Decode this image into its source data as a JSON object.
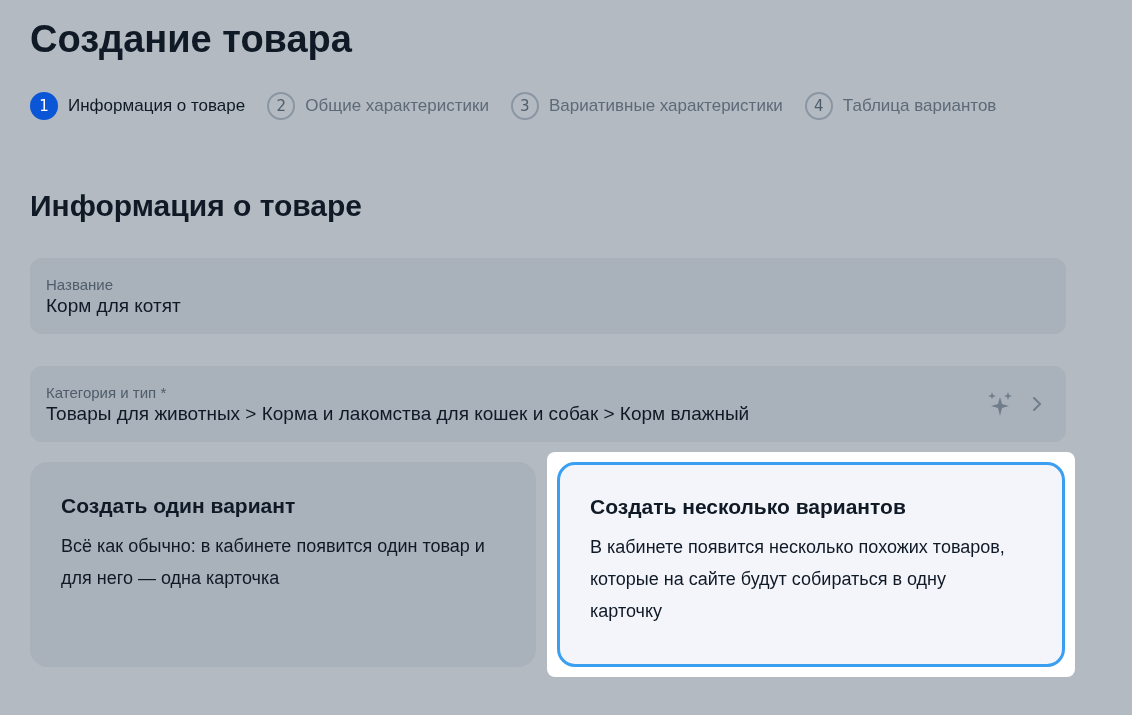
{
  "title": "Создание товара",
  "steps": [
    {
      "number": "1",
      "label": "Информация о товаре",
      "selected": true
    },
    {
      "number": "2",
      "label": "Общие характеристики",
      "selected": false
    },
    {
      "number": "3",
      "label": "Вариативные характеристики",
      "selected": false
    },
    {
      "number": "4",
      "label": "Таблица вариантов",
      "selected": false
    }
  ],
  "section_title": "Информация о товаре",
  "fields": [
    {
      "kind": "text",
      "label": "Название",
      "value": "Корм для котят"
    },
    {
      "kind": "picker",
      "label": "Категория и тип *",
      "value": "Товары для животных > Корма и лакомства для кошек и собак > Корм влажный"
    }
  ],
  "options": [
    {
      "title": "Создать один вариант",
      "description": "Всё как обычно: в кабинете появится один товар и для него — одна карточка",
      "selected": false
    },
    {
      "title": "Создать несколько вариантов",
      "description": "В кабинете появится несколько похожих товаров, которые на сайте будут собираться в одну карточку",
      "selected": true
    }
  ]
}
